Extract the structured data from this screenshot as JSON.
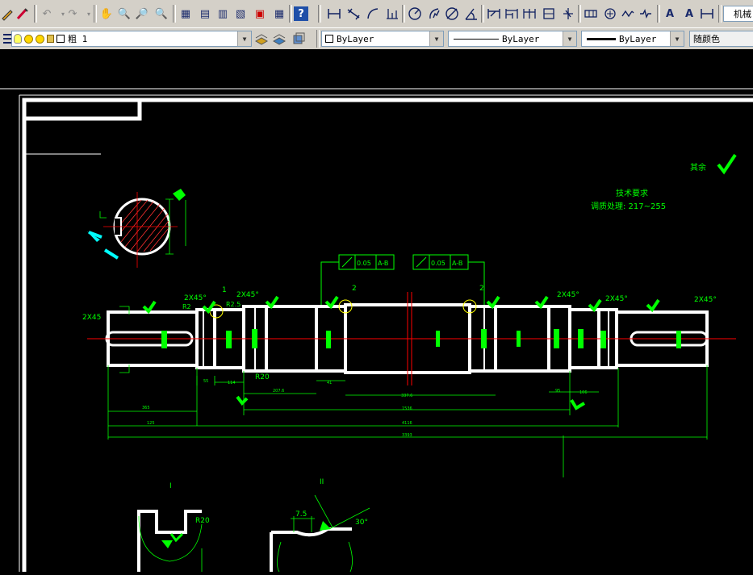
{
  "toolbar1": {
    "icons": [
      "pencil-icon",
      "brush-icon",
      "undo-icon",
      "redo-icon",
      "pan-icon",
      "zoom-realtime-icon",
      "zoom-window-icon",
      "zoom-previous-icon",
      "properties-icon",
      "design-center-icon",
      "tool-palettes-icon",
      "sheet-set-icon",
      "markup-icon",
      "calculator-icon",
      "help-icon",
      "linear-dimension-icon",
      "aligned-dimension-icon",
      "arc-length-icon",
      "ordinate-dimension-icon",
      "radius-dimension-icon",
      "jogged-dimension-icon",
      "diameter-dimension-icon",
      "angular-dimension-icon",
      "quick-dimension-icon",
      "baseline-dimension-icon",
      "continue-dimension-icon",
      "dimension-space-icon",
      "dimension-break-icon",
      "tolerance-icon",
      "center-mark-icon",
      "inspection-icon",
      "jogged-linear-icon",
      "dimension-edit-icon",
      "dimension-text-edit-icon",
      "dimension-update-icon"
    ],
    "dim_style_value": "机械"
  },
  "toolbar2": {
    "layer_name": "粗 1",
    "color_value": "ByLayer",
    "linetype_value": "ByLayer",
    "lineweight_value": "ByLayer",
    "plotstyle_value": "随颜色"
  },
  "drawing": {
    "roughness_note": "其余",
    "tech_title": "技术要求",
    "tech_line1": "调质处理: 217~255",
    "tol_value": "0.05",
    "tol_datum": "A-B",
    "chamfer": "2X45°",
    "chamfer_left": "2X45",
    "r2": "R2",
    "r2_5": "R2.5",
    "r20": "R20",
    "callout_1": "1",
    "callout_2": "2",
    "section_1": "I",
    "section_2": "II",
    "dim_7_5": "7.5",
    "dim_30": "30°",
    "dim_r20_detail": "R20",
    "dim_2076": "207.6",
    "dim_41": "41",
    "dim_3372": "337.6",
    "dim_1536": "1536",
    "dim_4116": "4116",
    "dim_3393": "3393",
    "dim_365": "365",
    "dim_125": "125",
    "dim_114": "114",
    "dim_55": "55",
    "dim_106": "106",
    "dim_95": "95"
  },
  "colors": {
    "outline": "#ffffff",
    "dimension": "#00ff00",
    "centerline": "#ff0000",
    "highlight": "#ffff00",
    "cyan": "#00ffff"
  }
}
